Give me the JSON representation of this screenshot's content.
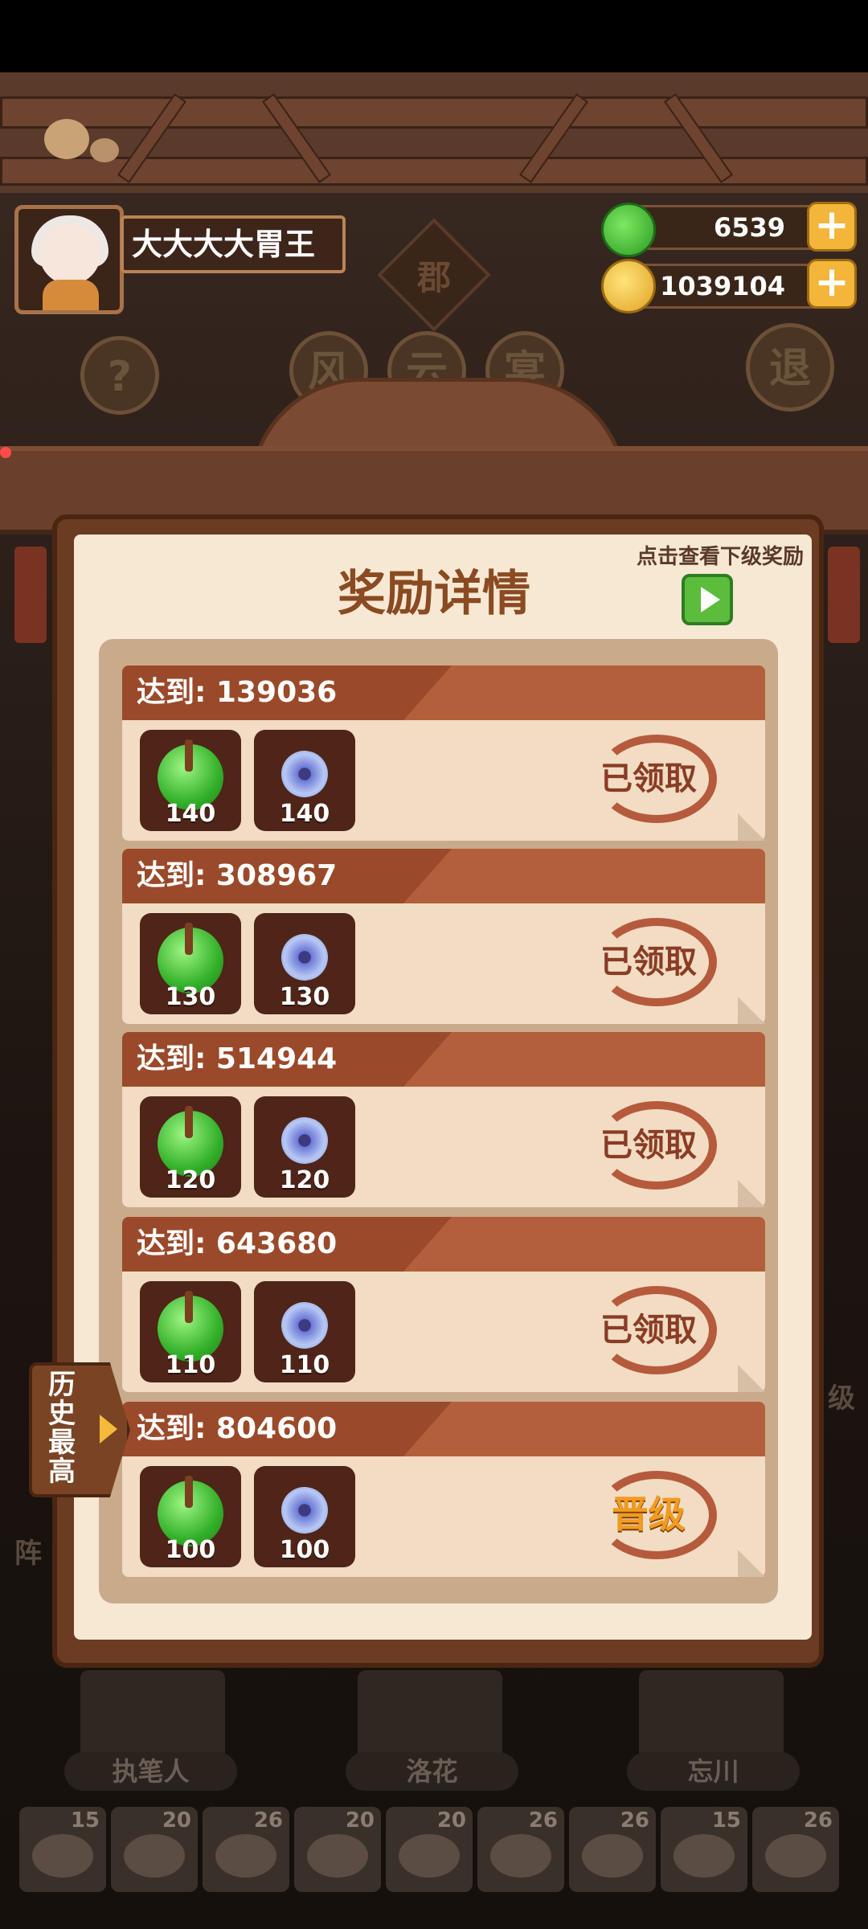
{
  "user": {
    "name": "大大大大胃王"
  },
  "currency": {
    "jade": "6539",
    "coins": "1039104"
  },
  "top_buttons": {
    "help": "?",
    "exit": "退",
    "sign": "郡",
    "round1": "风",
    "round2": "云",
    "round3": "宴"
  },
  "reward_panel": {
    "title": "奖励详情",
    "hint": "点击查看下级奖励",
    "rows": [
      {
        "target": "达到: 139036",
        "jade": "140",
        "orb": "140",
        "status": "已领取"
      },
      {
        "target": "达到: 308967",
        "jade": "130",
        "orb": "130",
        "status": "已领取"
      },
      {
        "target": "达到: 514944",
        "jade": "120",
        "orb": "120",
        "status": "已领取"
      },
      {
        "target": "达到: 643680",
        "jade": "110",
        "orb": "110",
        "status": "已领取"
      },
      {
        "target": "达到: 804600",
        "jade": "100",
        "orb": "100",
        "status": "晋级"
      }
    ]
  },
  "history_tab": "历史最高",
  "characters": [
    "执笔人",
    "洛花",
    "忘川"
  ],
  "foods": [
    "15",
    "20",
    "26",
    "20",
    "20",
    "26",
    "26",
    "15",
    "26"
  ],
  "side_labels": {
    "left": "阵",
    "right": "级"
  }
}
